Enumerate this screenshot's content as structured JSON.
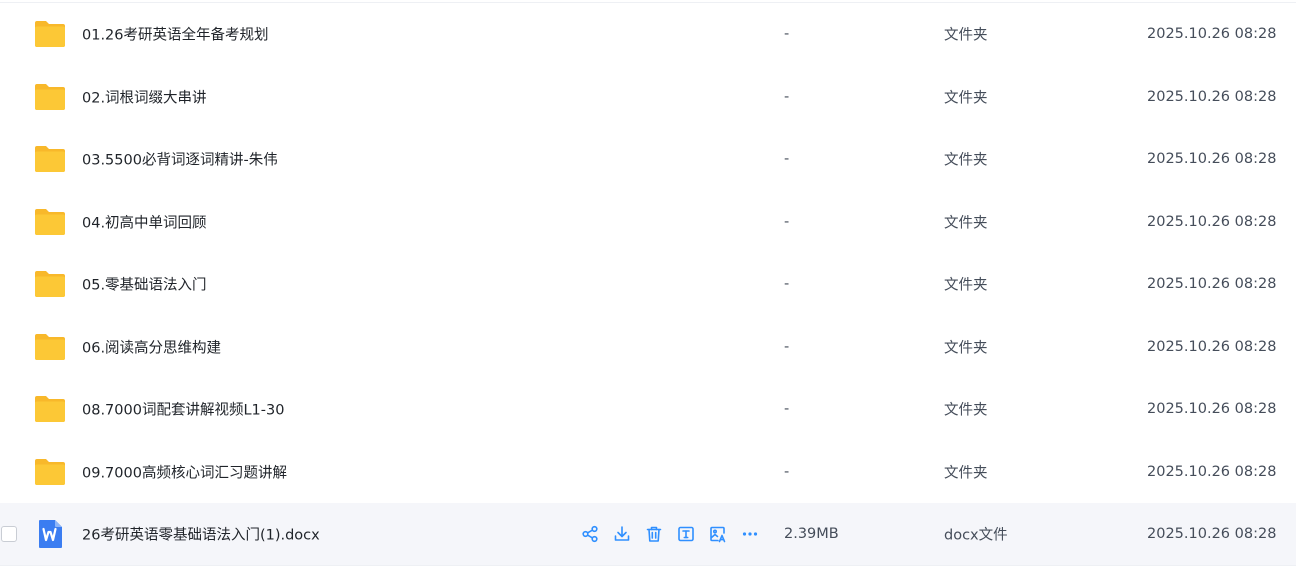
{
  "files": [
    {
      "name": "01.26考研英语全年备考规划",
      "size": "-",
      "type": "文件夹",
      "modified": "2025.10.26 08:28",
      "icon": "folder-icon"
    },
    {
      "name": "02.词根词缀大串讲",
      "size": "-",
      "type": "文件夹",
      "modified": "2025.10.26 08:28",
      "icon": "folder-icon"
    },
    {
      "name": "03.5500必背词逐词精讲-朱伟",
      "size": "-",
      "type": "文件夹",
      "modified": "2025.10.26 08:28",
      "icon": "folder-icon"
    },
    {
      "name": "04.初高中单词回顾",
      "size": "-",
      "type": "文件夹",
      "modified": "2025.10.26 08:28",
      "icon": "folder-icon"
    },
    {
      "name": "05.零基础语法入门",
      "size": "-",
      "type": "文件夹",
      "modified": "2025.10.26 08:28",
      "icon": "folder-icon"
    },
    {
      "name": "06.阅读高分思维构建",
      "size": "-",
      "type": "文件夹",
      "modified": "2025.10.26 08:28",
      "icon": "folder-icon"
    },
    {
      "name": "08.7000词配套讲解视频L1-30",
      "size": "-",
      "type": "文件夹",
      "modified": "2025.10.26 08:28",
      "icon": "folder-icon"
    },
    {
      "name": "09.7000高频核心词汇习题讲解",
      "size": "-",
      "type": "文件夹",
      "modified": "2025.10.26 08:28",
      "icon": "folder-icon"
    },
    {
      "name": "26考研英语零基础语法入门(1).docx",
      "size": "2.39MB",
      "type": "docx文件",
      "modified": "2025.10.26 08:28",
      "icon": "word-doc-icon",
      "hovered": true
    }
  ],
  "row_actions": [
    "share-icon",
    "download-icon",
    "delete-icon",
    "text-extract-icon",
    "image-translate-icon",
    "more-icon"
  ],
  "colors": {
    "folder": "#fcc836",
    "folder_back": "#f8b82a",
    "word": "#3b7df1",
    "action": "#2f8fff",
    "hover_bg": "#f5f6fa"
  }
}
